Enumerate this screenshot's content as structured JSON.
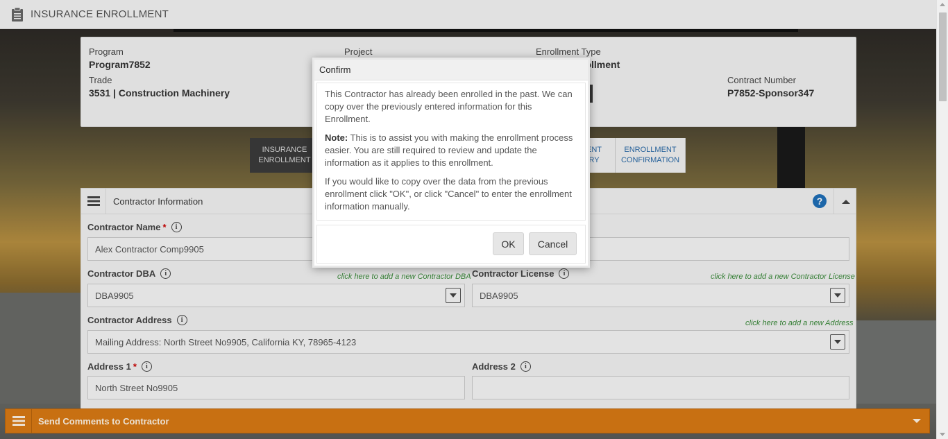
{
  "header": {
    "title": "INSURANCE ENROLLMENT",
    "icon": "clipboard-icon"
  },
  "info": {
    "program_label": "Program",
    "program_value": "Program7852",
    "project_label": "Project",
    "enrollment_type_label": "Enrollment Type",
    "enrollment_type_value": "rollment",
    "trade_label": "Trade",
    "trade_value": "3531 | Construction Machinery",
    "contract_number_label": "Contract Number",
    "contract_number_value": "P7852-Sponsor347"
  },
  "steps": [
    {
      "line1": "INSURANCE",
      "line2": "ENROLLMENT",
      "active": true
    },
    {
      "line1": "ENT",
      "line2": "RY",
      "active": false
    },
    {
      "line1": "ENROLLMENT",
      "line2": "CONFIRMATION",
      "active": false
    }
  ],
  "section": {
    "title": "Contractor Information",
    "help_icon": "?",
    "contractor_name_label": "Contractor Name",
    "contractor_name_value": "Alex Contractor Comp9905",
    "contractor_dba_label": "Contractor DBA",
    "contractor_dba_link": "click here to add a new Contractor DBA",
    "contractor_dba_value": "DBA9905",
    "contractor_license_label": "Contractor License",
    "contractor_license_link": "click here to add a new Contractor License",
    "contractor_license_value": "DBA9905",
    "contractor_address_label": "Contractor Address",
    "contractor_address_link": "click here to add a new Address",
    "contractor_address_value": "Mailing Address: North Street No9905, California KY, 78965-4123",
    "address1_label": "Address 1",
    "address1_value": "North Street No9905",
    "address2_label": "Address 2",
    "address2_value": "",
    "required_mark": "*",
    "info_mark": "i"
  },
  "bottom_bar": {
    "label": "Send Comments to Contractor"
  },
  "dialog": {
    "title": "Confirm",
    "para1": "This Contractor has already been enrolled in the past. We can copy over the previously entered information for this Enrollment.",
    "note_label": "Note:",
    "note_text": " This is to assist you with making the enrollment process easier. You are still required to review and update the information as it applies to this enrollment.",
    "para3": "If you would like to copy over the data from the previous enrollment click \"OK\", or click \"Cancel\" to enter the enrollment information manually.",
    "ok_label": "OK",
    "cancel_label": "Cancel"
  },
  "colors": {
    "accent_orange": "#d97a14",
    "link_blue": "#2a6aa8",
    "help_blue": "#1f6fb8",
    "link_green": "#3a8a3a"
  }
}
